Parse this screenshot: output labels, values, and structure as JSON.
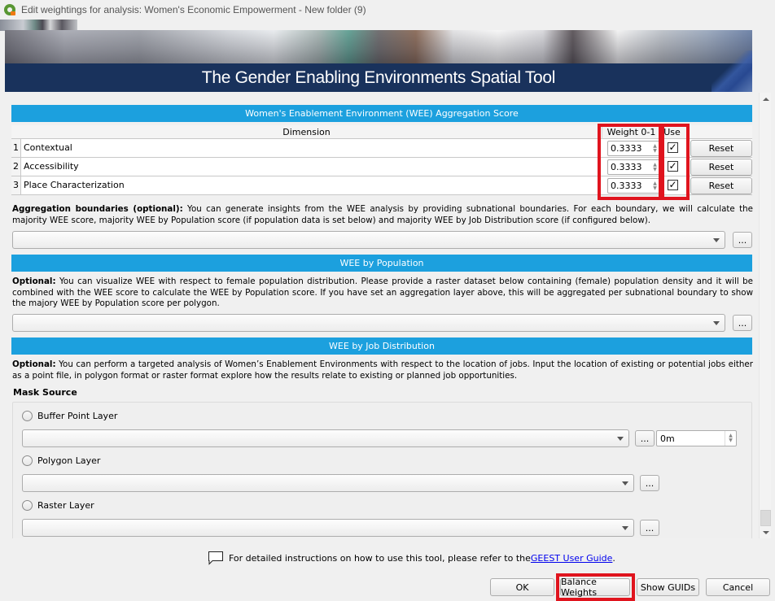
{
  "window": {
    "title": "Edit weightings for analysis: Women's Economic Empowerment - New folder (9)",
    "app_icon": "qgis-logo-icon"
  },
  "banner": {
    "title": "The Gender Enabling Environments Spatial Tool"
  },
  "aggregation_score": {
    "header": "Women's Enablement Environment (WEE) Aggregation Score",
    "columns": [
      "Dimension",
      "Weight 0-1",
      "Use"
    ],
    "rows": [
      {
        "index": "1",
        "dimension": "Contextual",
        "weight": "0.3333",
        "use": true,
        "reset_label": "Reset"
      },
      {
        "index": "2",
        "dimension": "Accessibility",
        "weight": "0.3333",
        "use": true,
        "reset_label": "Reset"
      },
      {
        "index": "3",
        "dimension": "Place Characterization",
        "weight": "0.3333",
        "use": true,
        "reset_label": "Reset"
      }
    ],
    "check_glyph": "✓"
  },
  "aggregation_boundaries": {
    "label_bold": "Aggregation boundaries (optional):",
    "text": " You can generate insights from the WEE analysis by providing subnational boundaries. For each boundary, we will calculate the majority WEE score, majority WEE by Population score (if population data is set below) and majority WEE by Job Distribution score (if configured below).",
    "combo_value": "",
    "browse_label": "..."
  },
  "population": {
    "header": "WEE by Population",
    "label_bold": "Optional:",
    "text": " You can visualize WEE with respect to female population distribution. Please provide a raster dataset below containing (female) population density and it will be combined with the WEE score to calculate the WEE by Population score. If you have set an aggregation layer above, this will be aggregated per subnational boundary to show the majory WEE by Population score per polygon.",
    "combo_value": "",
    "browse_label": "..."
  },
  "job_distribution": {
    "header": "WEE by Job Distribution",
    "label_bold": "Optional:",
    "text": " You can perform a targeted analysis of Women’s Enablement Environments with respect to the location of jobs. Input the location of existing or potential jobs either as a point file, in polygon format or raster format explore how the results relate to existing or planned job opportunities.",
    "mask_source_label": "Mask Source",
    "options": [
      {
        "label": "Buffer Point Layer",
        "selected": false
      },
      {
        "label": "Polygon Layer",
        "selected": false
      },
      {
        "label": "Raster Layer",
        "selected": false
      }
    ],
    "buffer_value": "0m",
    "browse_label": "..."
  },
  "help": {
    "text": "For detailed instructions on how to use this tool, please refer to the ",
    "link": "GEEST User Guide",
    "suffix": "."
  },
  "footer": {
    "ok": "OK",
    "balance": "Balance Weights",
    "show_guids": "Show GUIDs",
    "cancel": "Cancel"
  },
  "colors": {
    "section_header": "#1ca0de",
    "banner_bar": "#19325c",
    "highlight": "#e0141e"
  }
}
